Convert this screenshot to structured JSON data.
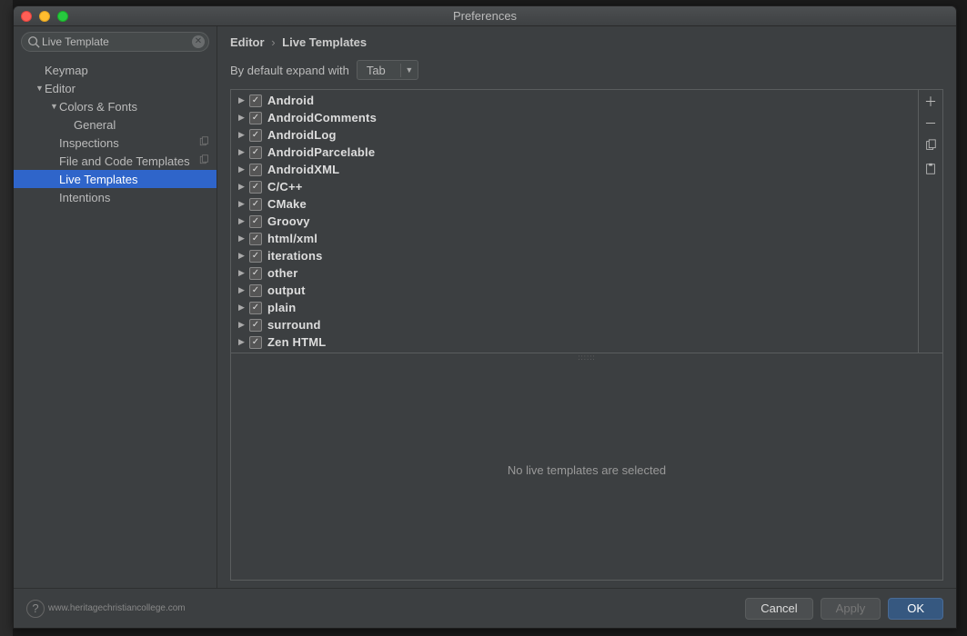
{
  "window": {
    "title": "Preferences"
  },
  "search": {
    "value": "Live Template",
    "placeholder": ""
  },
  "sidebar": {
    "items": [
      {
        "label": "Keymap",
        "expandable": false,
        "indent": 1,
        "icon": ""
      },
      {
        "label": "Editor",
        "expandable": true,
        "indent": 1,
        "icon": ""
      },
      {
        "label": "Colors & Fonts",
        "expandable": true,
        "indent": 2,
        "icon": ""
      },
      {
        "label": "General",
        "expandable": false,
        "indent": 3,
        "icon": ""
      },
      {
        "label": "Inspections",
        "expandable": false,
        "indent": 2,
        "icon": "copy"
      },
      {
        "label": "File and Code Templates",
        "expandable": false,
        "indent": 2,
        "icon": "copy"
      },
      {
        "label": "Live Templates",
        "expandable": false,
        "indent": 2,
        "selected": true,
        "icon": ""
      },
      {
        "label": "Intentions",
        "expandable": false,
        "indent": 2,
        "icon": ""
      }
    ]
  },
  "breadcrumb": {
    "parent": "Editor",
    "child": "Live Templates"
  },
  "expand": {
    "label": "By default expand with",
    "value": "Tab"
  },
  "templates": [
    {
      "name": "Android",
      "checked": true
    },
    {
      "name": "AndroidComments",
      "checked": true
    },
    {
      "name": "AndroidLog",
      "checked": true
    },
    {
      "name": "AndroidParcelable",
      "checked": true
    },
    {
      "name": "AndroidXML",
      "checked": true
    },
    {
      "name": "C/C++",
      "checked": true
    },
    {
      "name": "CMake",
      "checked": true
    },
    {
      "name": "Groovy",
      "checked": true
    },
    {
      "name": "html/xml",
      "checked": true
    },
    {
      "name": "iterations",
      "checked": true
    },
    {
      "name": "other",
      "checked": true
    },
    {
      "name": "output",
      "checked": true
    },
    {
      "name": "plain",
      "checked": true
    },
    {
      "name": "surround",
      "checked": true
    },
    {
      "name": "Zen HTML",
      "checked": true
    }
  ],
  "detail": {
    "empty_text": "No live templates are selected"
  },
  "footer": {
    "watermark": "www.heritagechristiancollege.com",
    "cancel": "Cancel",
    "apply": "Apply",
    "ok": "OK"
  }
}
